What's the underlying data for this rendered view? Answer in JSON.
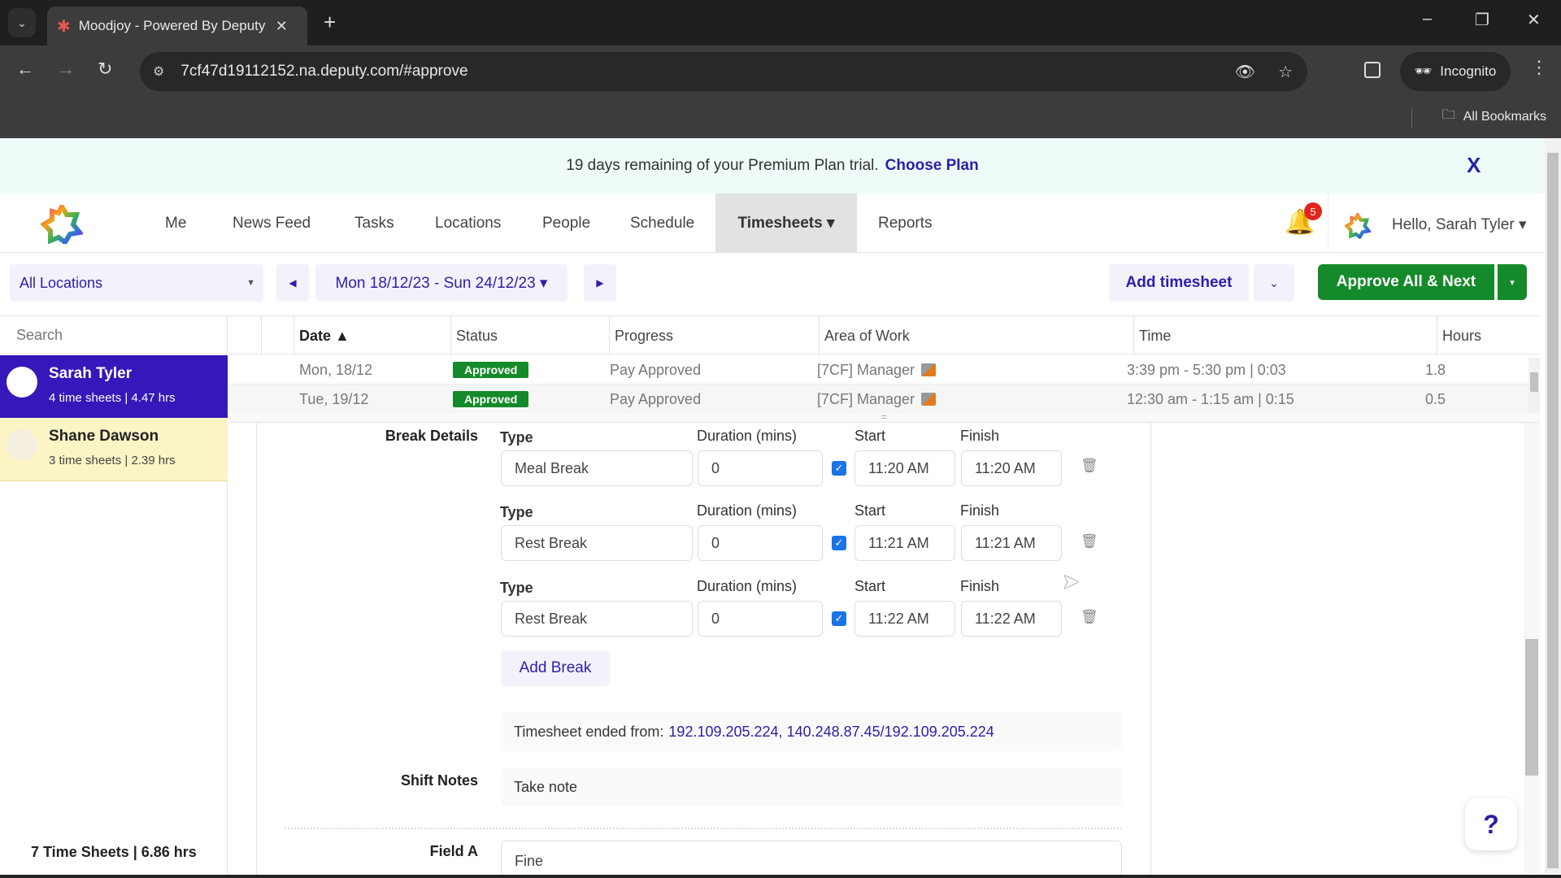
{
  "browser": {
    "tab_title": "Moodjoy - Powered By Deputy",
    "url": "7cf47d19112152.na.deputy.com/#approve",
    "profile_label": "Incognito",
    "bookmarks_label": "All Bookmarks",
    "icons": {
      "tab_list": "⌄",
      "close_tab": "✕",
      "new_tab": "+",
      "minimize": "–",
      "restore": "❐",
      "close_window": "✕",
      "back": "←",
      "forward": "→",
      "reload": "↻",
      "site_info": "⚙",
      "eye_off": "👁",
      "star": "☆",
      "menu": "⋮",
      "folder": "🗀"
    }
  },
  "banner": {
    "message": "19 days remaining of your Premium Plan trial.",
    "link": "Choose Plan",
    "close": "X"
  },
  "nav": {
    "items": [
      "Me",
      "News Feed",
      "Tasks",
      "Locations",
      "People",
      "Schedule",
      "Timesheets ▾",
      "Reports"
    ],
    "active": "Timesheets",
    "notifications_count": "5",
    "greeting": "Hello, Sarah Tyler ▾"
  },
  "toolbar": {
    "location": "All Locations",
    "week_range": "Mon 18/12/23 - Sun 24/12/23 ▾",
    "prev": "◀",
    "next": "▶",
    "add_timesheet": "Add timesheet",
    "add_menu": "⌄",
    "approve_next": "Approve All & Next",
    "approve_menu": "▾"
  },
  "sidebar": {
    "search_placeholder": "Search",
    "employees": [
      {
        "name": "Sarah Tyler",
        "summary": "4 time sheets | 4.47 hrs",
        "selected": true
      },
      {
        "name": "Shane Dawson",
        "summary": "3 time sheets | 2.39 hrs",
        "selected": false
      }
    ],
    "total": "7 Time Sheets | 6.86 hrs"
  },
  "table": {
    "columns": [
      "Date ▲",
      "Status",
      "Progress",
      "Area of Work",
      "Time",
      "Hours"
    ],
    "rows": [
      {
        "date": "Mon, 18/12",
        "status": "Approved",
        "progress": "Pay Approved",
        "area": "[7CF] Manager",
        "time": "3:39 pm - 5:30 pm | 0:03",
        "hours": "1.8"
      },
      {
        "date": "Tue, 19/12",
        "status": "Approved",
        "progress": "Pay Approved",
        "area": "[7CF] Manager",
        "time": "12:30 am - 1:15 am | 0:15",
        "hours": "0.5"
      }
    ],
    "status_color": "#148a2a"
  },
  "detail": {
    "break_details_label": "Break Details",
    "field_labels": {
      "type": "Type",
      "duration": "Duration (mins)",
      "start": "Start",
      "finish": "Finish"
    },
    "breaks": [
      {
        "type": "Meal Break",
        "duration": "0",
        "checked": true,
        "start": "11:20 AM",
        "finish": "11:20 AM"
      },
      {
        "type": "Rest Break",
        "duration": "0",
        "checked": true,
        "start": "11:21 AM",
        "finish": "11:21 AM"
      },
      {
        "type": "Rest Break",
        "duration": "0",
        "checked": true,
        "start": "11:22 AM",
        "finish": "11:22 AM"
      }
    ],
    "add_break": "Add Break",
    "ip_label": "Timesheet ended from:",
    "ip_values": "192.109.205.224, 140.248.87.45/192.109.205.224",
    "shift_notes_label": "Shift Notes",
    "shift_notes": "Take note",
    "field_a_label": "Field A",
    "field_a_value": "Fine"
  },
  "help_label": "?",
  "colors": {
    "brand": "#3517ba",
    "link": "#2b1fa8",
    "approve": "#148a2a",
    "banner_bg": "#effbf9",
    "selected_alt": "#fbf4c5"
  }
}
